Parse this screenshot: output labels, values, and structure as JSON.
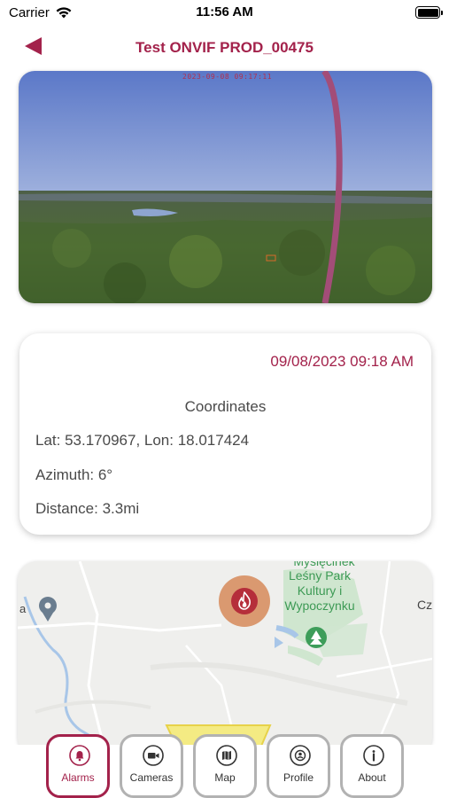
{
  "status_bar": {
    "carrier": "Carrier",
    "time": "11:56 AM"
  },
  "header": {
    "title": "Test ONVIF PROD_00475",
    "back_icon": "triangle-left-icon"
  },
  "camera": {
    "timestamp": "2023-09-08 09:17:11"
  },
  "alarm": {
    "date": "09/08/2023 09:18 AM",
    "coordinates_title": "Coordinates",
    "latlon": "Lat: 53.170967, Lon: 18.017424",
    "azimuth": "Azimuth: 6°",
    "distance": "Distance: 3.3mi"
  },
  "map": {
    "label_top": "Myślęcinek",
    "park_label": "Leśny Park Kultury i Wypoczynku",
    "label_right": "Cz",
    "label_left": "a",
    "marker_icon": "fire-icon"
  },
  "tabs": [
    {
      "label": "Alarms",
      "icon": "bell-icon",
      "active": true
    },
    {
      "label": "Cameras",
      "icon": "video-camera-icon",
      "active": false
    },
    {
      "label": "Map",
      "icon": "map-icon",
      "active": false
    },
    {
      "label": "Profile",
      "icon": "profile-icon",
      "active": false
    },
    {
      "label": "About",
      "icon": "info-icon",
      "active": false
    }
  ],
  "colors": {
    "accent": "#a3224b",
    "tab_border": "#b2b2b2",
    "text": "#4a4a4a"
  }
}
